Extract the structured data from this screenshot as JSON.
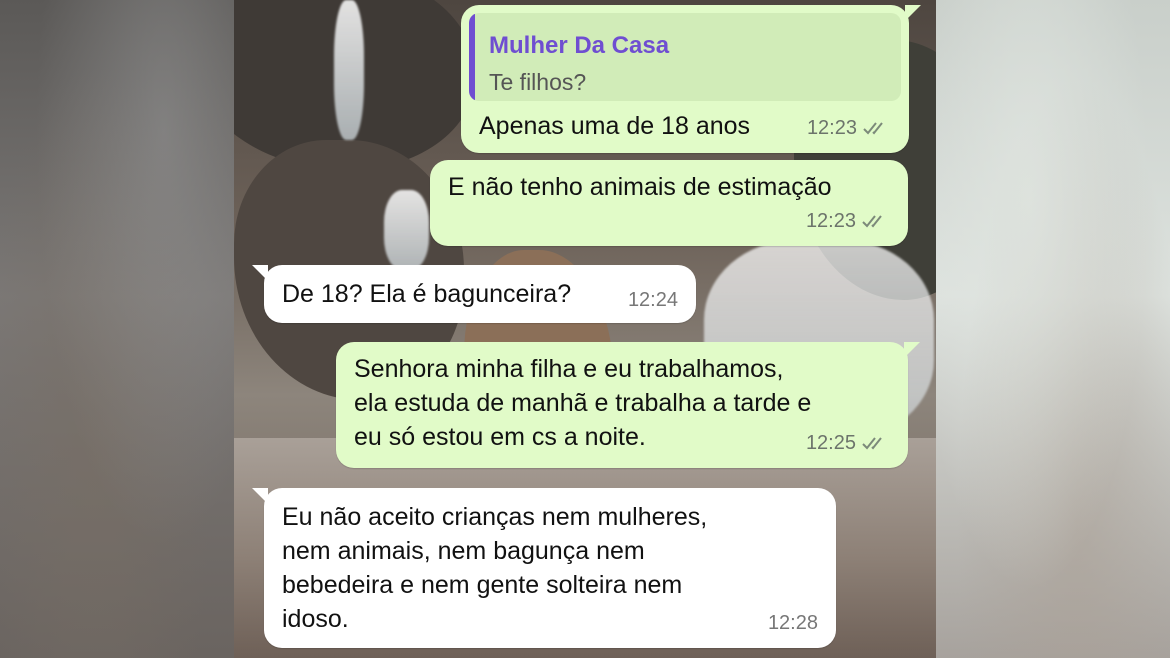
{
  "chat": {
    "messages": [
      {
        "direction": "outgoing",
        "reply_to": {
          "author": "Mulher Da Casa",
          "text": "Te filhos?"
        },
        "text": "Apenas uma de 18 anos",
        "time": "12:23",
        "status_icon": "double-check-icon"
      },
      {
        "direction": "outgoing",
        "text": "E não tenho animais de estimação",
        "time": "12:23",
        "status_icon": "double-check-icon"
      },
      {
        "direction": "incoming",
        "text": "De 18? Ela é bagunceira?",
        "time": "12:24"
      },
      {
        "direction": "outgoing",
        "text": "Senhora minha filha e eu trabalhamos,\nela estuda de manhã e trabalha a tarde e\neu só estou em cs a noite.",
        "time": "12:25",
        "status_icon": "double-check-icon"
      },
      {
        "direction": "incoming",
        "text": "Eu não aceito crianças nem mulheres,\nnem animais, nem bagunça nem\nbebedeira e nem gente solteira nem\nidoso.",
        "time": "12:28"
      }
    ]
  },
  "colors": {
    "outgoing_bubble": "#e1fbc8",
    "incoming_bubble": "#ffffff",
    "quote_accent": "#6f4ed1",
    "quote_background": "#d1ecb8"
  }
}
